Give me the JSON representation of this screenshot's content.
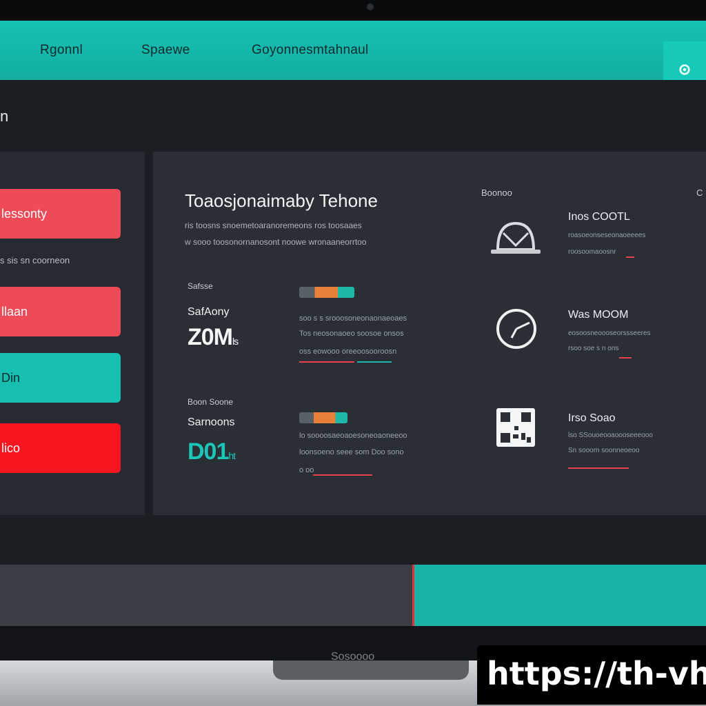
{
  "nav": {
    "items": [
      "Rgonnl",
      "Spaewe",
      "Goyonnesmtahnaul"
    ],
    "icon": "settings-icon"
  },
  "screen": {
    "title": "n"
  },
  "sidebar": {
    "buttons": [
      {
        "label": "lessonty",
        "color": "#ef4a57"
      },
      {
        "label": "llaan",
        "color": "#ee4a58"
      },
      {
        "label": "Din",
        "color": "#16bfb0"
      },
      {
        "label": "lico",
        "color": "#f7161f"
      }
    ],
    "caption": "s sis sn coorneon"
  },
  "main": {
    "title": "Toaosjonaimaby Tehone",
    "subtitle_1": "ris toosns  snoemetoaranoremeons ros toosaaes",
    "subtitle_2": "w sooo toosonornanosont  noowe wronaaneorrtoo"
  },
  "stats": [
    {
      "label": "Safsse",
      "name": "SafAony",
      "value": "Z0M",
      "suffix": "ls"
    },
    {
      "label": "Boon Soone",
      "name": "Sarnoons",
      "value": "D01",
      "suffix": "ht"
    }
  ],
  "details": [
    {
      "line1": "soo s s srooosoneonaonaeoaes",
      "line2": "Tos neosonaoeo  soosoe onsos",
      "line3": "oss eowooo   oreeoosooroosn"
    },
    {
      "line1": "lo soooosaeoaoesoneoaoneeoo",
      "line2": "loonsoeno seee som Doo  sono",
      "line3": "o                  oo"
    }
  ],
  "right": {
    "header": "Boonoo",
    "header_c": "C",
    "items": [
      {
        "icon": "helmet-icon",
        "title": "Inos COOTL",
        "line1": "roasoeonseseonaoeeees",
        "line2": "roosoomaoosnr"
      },
      {
        "icon": "clock-icon",
        "title": "Was MOOM",
        "line1": "eosoosneoooseorssseeres",
        "line2": "rsoo soe s n   ons"
      },
      {
        "icon": "qr-code-icon",
        "title": "Irso Soao",
        "line1": "lso SSouoeooaoooseeeooo",
        "line2": "Sn sooorn   soonneoeoo"
      }
    ]
  },
  "bezel": {
    "brand": "Sosoooo"
  },
  "watermark": {
    "url": "https://th-vh"
  },
  "colors": {
    "accent_teal": "#16c2b3",
    "accent_red": "#ef4a57",
    "bright_red": "#f7161f",
    "panel": "#2a2f36",
    "background": "#1b1f24"
  }
}
